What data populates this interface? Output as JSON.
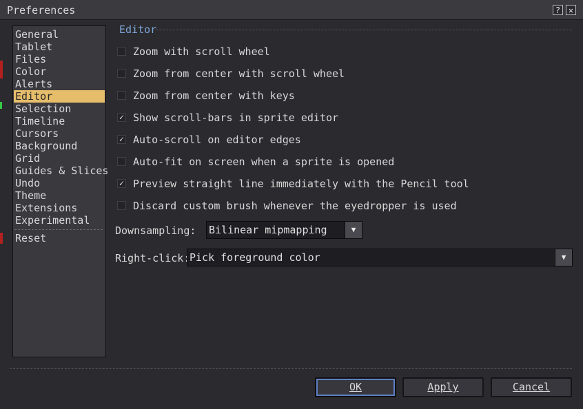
{
  "window": {
    "title": "Preferences",
    "help_glyph": "?",
    "close_glyph": "✕"
  },
  "sidebar": {
    "items": [
      {
        "label": "General"
      },
      {
        "label": "Tablet"
      },
      {
        "label": "Files"
      },
      {
        "label": "Color"
      },
      {
        "label": "Alerts"
      },
      {
        "label": "Editor"
      },
      {
        "label": "Selection"
      },
      {
        "label": "Timeline"
      },
      {
        "label": "Cursors"
      },
      {
        "label": "Background"
      },
      {
        "label": "Grid"
      },
      {
        "label": "Guides & Slices"
      },
      {
        "label": "Undo"
      },
      {
        "label": "Theme"
      },
      {
        "label": "Extensions"
      },
      {
        "label": "Experimental"
      }
    ],
    "selected": "Editor",
    "reset": "Reset"
  },
  "section": {
    "title": "Editor"
  },
  "options": [
    {
      "label": "Zoom with scroll wheel",
      "checked": false
    },
    {
      "label": "Zoom from center with scroll wheel",
      "checked": false
    },
    {
      "label": "Zoom from center with keys",
      "checked": false
    },
    {
      "label": "Show scroll-bars in sprite editor",
      "checked": true
    },
    {
      "label": "Auto-scroll on editor edges",
      "checked": true
    },
    {
      "label": "Auto-fit on screen when a sprite is opened",
      "checked": false
    },
    {
      "label": "Preview straight line immediately with the Pencil tool",
      "checked": true
    },
    {
      "label": "Discard custom brush whenever the eyedropper is used",
      "checked": false
    }
  ],
  "downsampling": {
    "label": "Downsampling:",
    "value": "Bilinear mipmapping"
  },
  "right_click": {
    "label": "Right-click:",
    "value": "Pick foreground color"
  },
  "buttons": {
    "ok": "OK",
    "apply": "Apply",
    "cancel": "Cancel"
  },
  "colors": {
    "accent": "#e5bd6b",
    "section_title": "#7fa8da",
    "background": "#2b2a2e"
  }
}
